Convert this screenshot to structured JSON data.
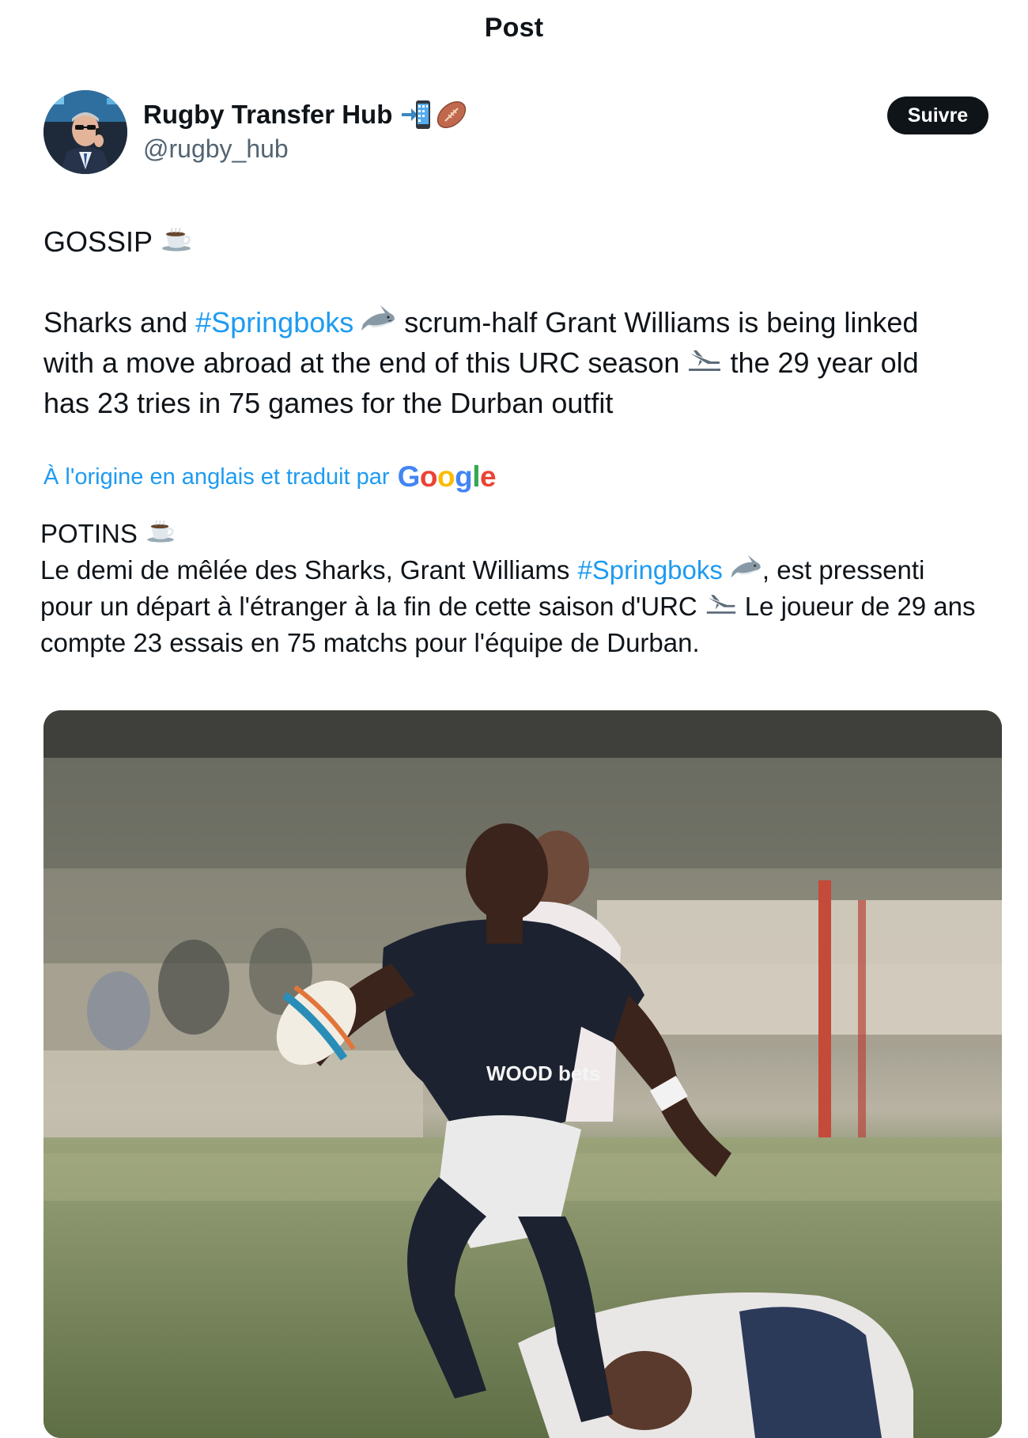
{
  "header": {
    "title": "Post"
  },
  "author": {
    "display_name": "Rugby Transfer Hub",
    "handle": "@rugby_hub",
    "name_emojis": [
      "mobile-phone-arrow-icon",
      "rugby-ball-icon"
    ],
    "follow_label": "Suivre"
  },
  "post": {
    "line1": "GOSSIP",
    "line2_a": "Sharks and",
    "line2_tag": "#Springboks",
    "line2_b": "scrum-half Grant Williams is being linked",
    "line3_a": "with a move abroad at the end of this URC season",
    "line3_b": "the 29 year old",
    "line4": "has 23 tries in 75 games for the Durban outfit",
    "icons": [
      "coffee-icon",
      "shark-icon",
      "airplane-landing-icon"
    ]
  },
  "translation": {
    "note": "À l'origine en anglais et traduit par",
    "provider": "Google",
    "line1": "POTINS",
    "line2_a": "Le demi de mêlée des Sharks, Grant Williams",
    "line2_tag": "#Springboks",
    "line2_b": ", est pressenti",
    "line3_a": "pour un départ à l'étranger à la fin de cette saison d'URC",
    "line3_b": "Le joueur de 29 ans",
    "line4": "compte 23 essais en 75 matchs pour l'équipe de Durban."
  },
  "media": {
    "description_icon": "rugby-action-photo",
    "jersey_text": "WOOD bets"
  },
  "colors": {
    "link": "#1d9bf0",
    "text": "#0f1419",
    "secondary": "#536471",
    "button": "#0f1419"
  }
}
